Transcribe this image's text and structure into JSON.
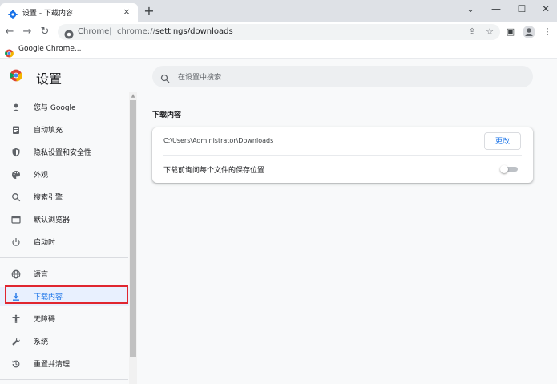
{
  "tab": {
    "title": "设置 - 下载内容",
    "icon": "gear-icon",
    "close_label": "×",
    "new_tab_label": "+"
  },
  "window": {
    "minimize": "—",
    "restore": "☐",
    "close": "✕",
    "chevron": "⌄"
  },
  "toolbar": {
    "back": "←",
    "forward": "→",
    "reload": "↻",
    "scheme_label": "Chrome",
    "url_host": "chrome://",
    "url_path": "settings/downloads",
    "share": "⇪",
    "star": "☆",
    "side_panel": "▣",
    "menu": "⋮"
  },
  "bookmarks": [
    {
      "label": "Google Chrome...",
      "icon": "chrome-icon"
    }
  ],
  "settings": {
    "title": "设置",
    "search_placeholder": "在设置中搜索"
  },
  "sidebar": {
    "items": [
      {
        "label": "您与 Google",
        "icon": "person-icon"
      },
      {
        "label": "自动填充",
        "icon": "clipboard-icon"
      },
      {
        "label": "隐私设置和安全性",
        "icon": "shield-icon"
      },
      {
        "label": "外观",
        "icon": "palette-icon"
      },
      {
        "label": "搜索引擎",
        "icon": "search-icon"
      },
      {
        "label": "默认浏览器",
        "icon": "browser-icon"
      },
      {
        "label": "启动时",
        "icon": "power-icon"
      },
      {
        "label": "语言",
        "icon": "globe-icon"
      },
      {
        "label": "下载内容",
        "icon": "download-icon",
        "selected": true
      },
      {
        "label": "无障碍",
        "icon": "accessibility-icon"
      },
      {
        "label": "系统",
        "icon": "wrench-icon"
      },
      {
        "label": "重置并清理",
        "icon": "reset-icon"
      }
    ]
  },
  "downloads": {
    "section_title": "下载内容",
    "location": "C:\\Users\\Administrator\\Downloads",
    "change_button": "更改",
    "ask_label": "下载前询问每个文件的保存位置",
    "ask_enabled": false
  },
  "colors": {
    "accent": "#1a73e8",
    "highlight_border": "#e0262f",
    "page_bg": "#f8f9fa"
  }
}
